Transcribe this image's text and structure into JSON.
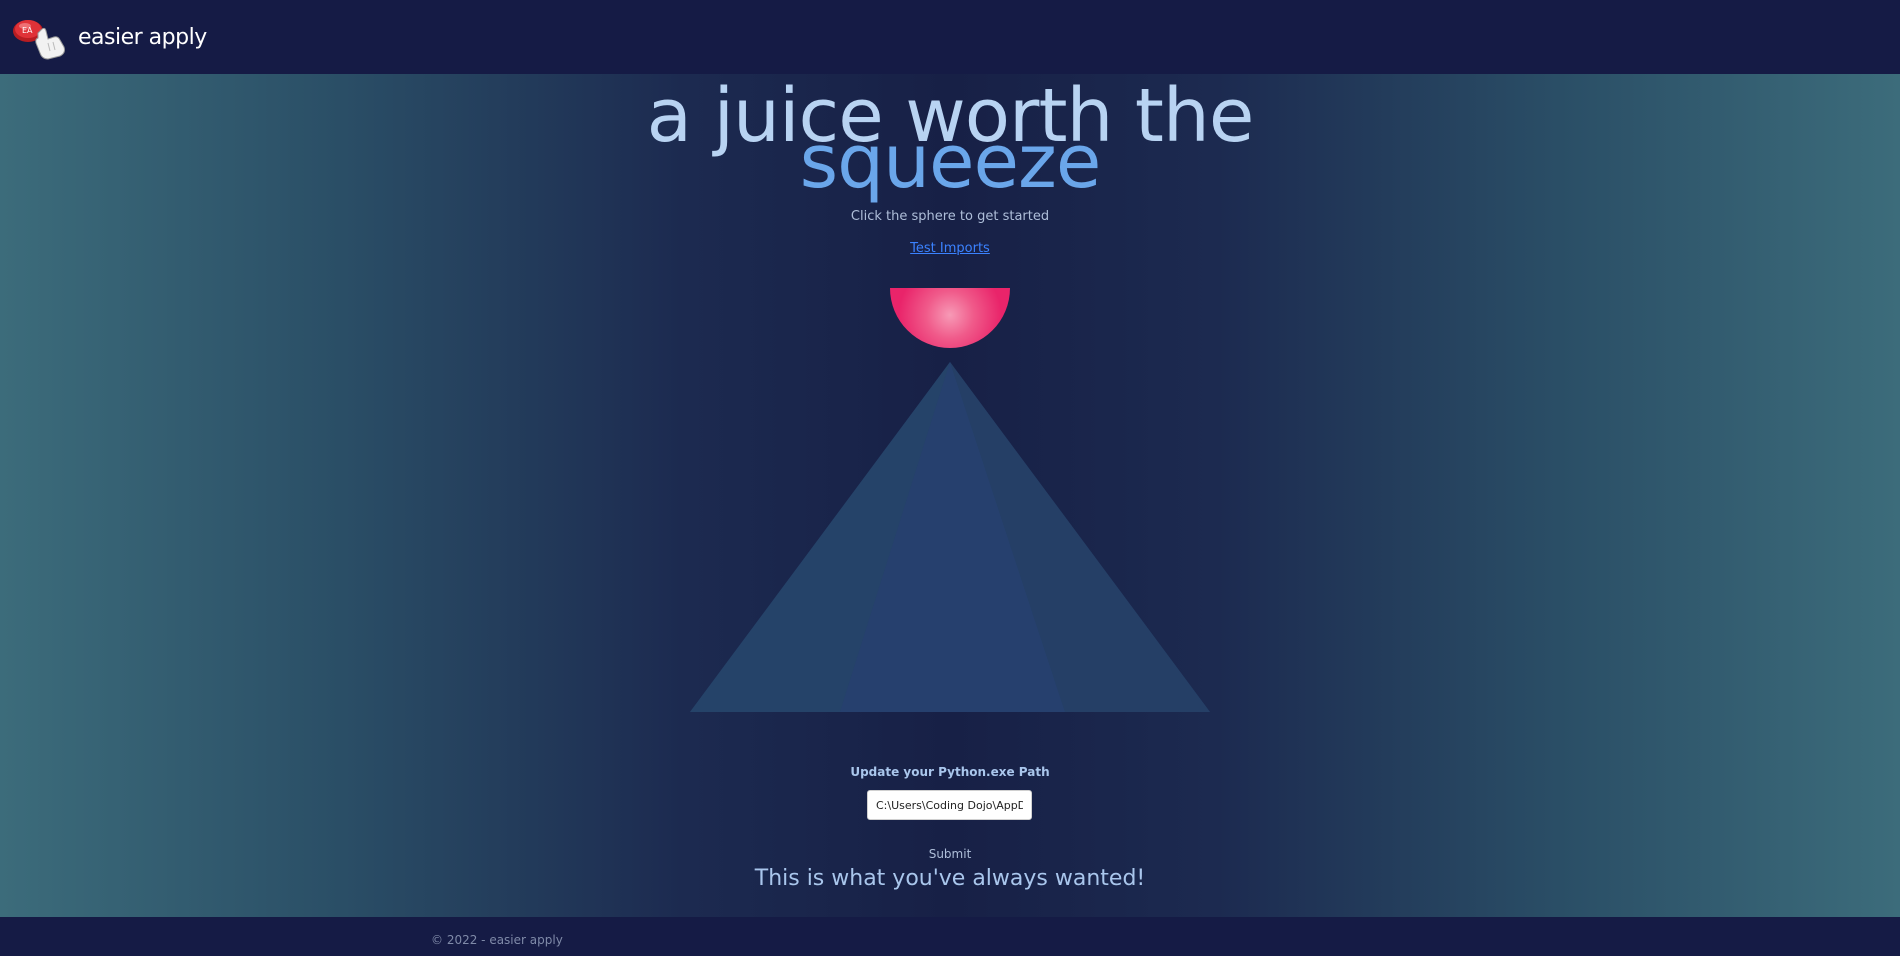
{
  "navbar": {
    "brand_text": "easier apply",
    "logo_icon": "hand-clicking-red-button-icon"
  },
  "hero": {
    "line1": "a juice worth the",
    "line2": "squeeze",
    "subtitle": "Click the sphere to get started",
    "test_link": "Test Imports"
  },
  "graphic": {
    "sphere_icon": "half-sphere-icon",
    "pyramid_icon": "pyramid-icon",
    "sphere_color": "#ee2d6f",
    "pyramid_color": "#25416a"
  },
  "form": {
    "label": "Update your Python.exe Path",
    "path_value": "C:\\Users\\Coding Dojo\\AppData",
    "submit_label": "Submit"
  },
  "tagline": "This is what you've always wanted!",
  "footer": {
    "text": "© 2022 - easier apply"
  },
  "colors": {
    "navbar_bg": "#151b45",
    "accent_blue": "#6aa6ea",
    "link_blue": "#3b82ff"
  }
}
